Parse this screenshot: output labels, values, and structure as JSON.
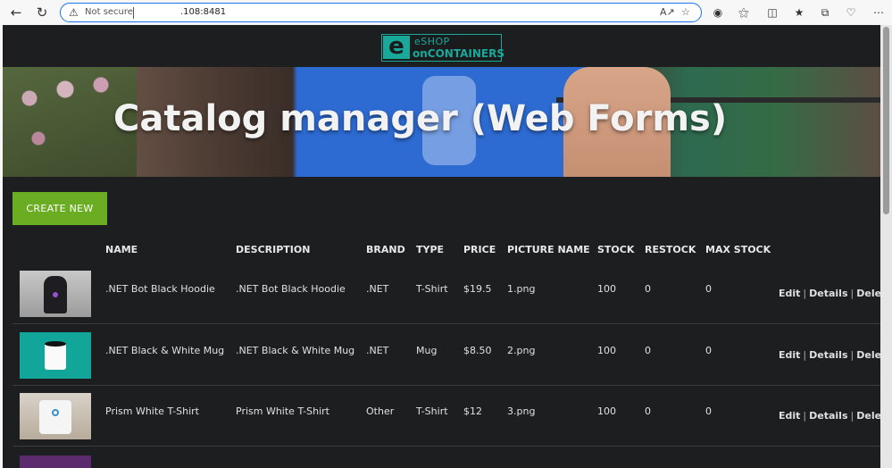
{
  "browser": {
    "security_label": "Not secure",
    "url": ".108:8481"
  },
  "app": {
    "logo_letter": "e",
    "logo_line1": "eSHOP",
    "logo_line2": "onCONTAINERS",
    "hero_title": "Catalog manager (Web Forms)",
    "create_button": "CREATE NEW"
  },
  "table": {
    "headers": {
      "name": "NAME",
      "description": "DESCRIPTION",
      "brand": "BRAND",
      "type": "TYPE",
      "price": "PRICE",
      "picture": "PICTURE NAME",
      "stock": "STOCK",
      "restock": "RESTOCK",
      "maxstock": "MAX STOCK"
    },
    "actions": {
      "edit": "Edit",
      "details": "Details",
      "delete": "Delete",
      "separator": "|"
    },
    "rows": [
      {
        "name": ".NET Bot Black Hoodie",
        "description": ".NET Bot Black Hoodie",
        "brand": ".NET",
        "type": "T-Shirt",
        "price": "$19.5",
        "picture": "1.png",
        "stock": "100",
        "restock": "0",
        "maxstock": "0"
      },
      {
        "name": ".NET Black & White Mug",
        "description": ".NET Black & White Mug",
        "brand": ".NET",
        "type": "Mug",
        "price": "$8.50",
        "picture": "2.png",
        "stock": "100",
        "restock": "0",
        "maxstock": "0"
      },
      {
        "name": "Prism White T-Shirt",
        "description": "Prism White T-Shirt",
        "brand": "Other",
        "type": "T-Shirt",
        "price": "$12",
        "picture": "3.png",
        "stock": "100",
        "restock": "0",
        "maxstock": "0"
      }
    ]
  }
}
